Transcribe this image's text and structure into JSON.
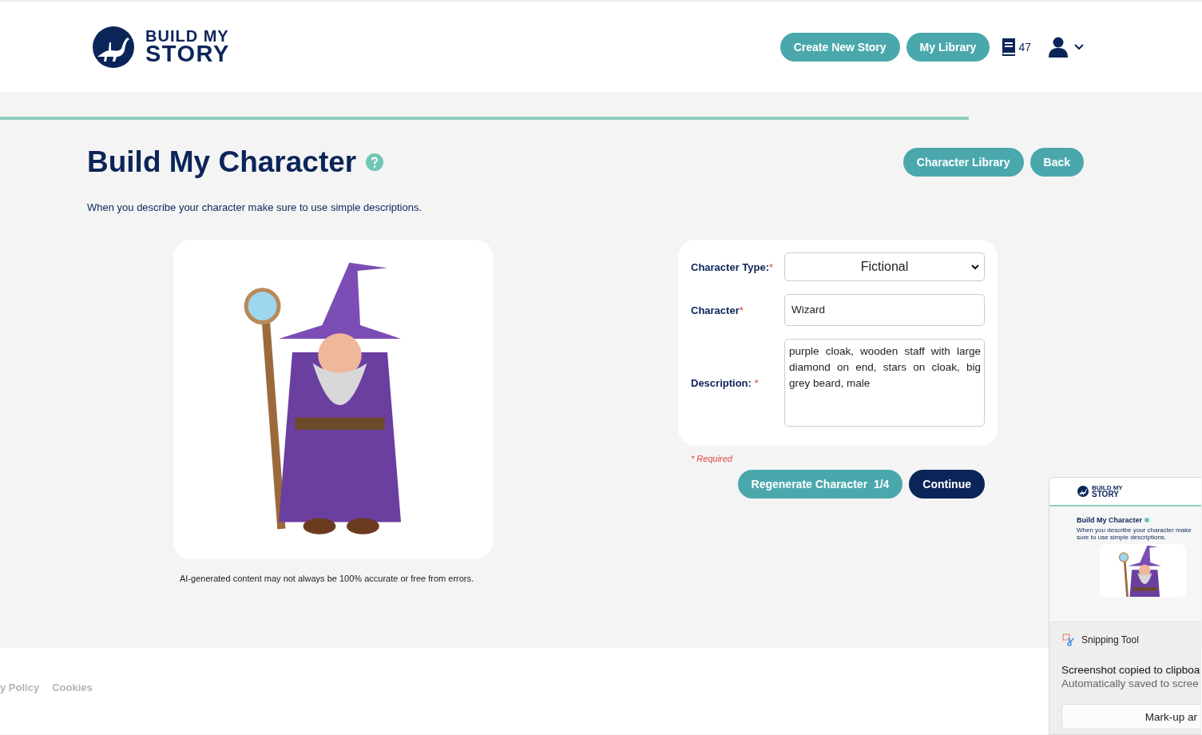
{
  "header": {
    "logo": {
      "line1": "BUILD MY",
      "line2": "STORY"
    },
    "buttons": [
      "Create New Story",
      "My Library"
    ],
    "library_count": "47"
  },
  "progress": {
    "level": 0.806
  },
  "page": {
    "title": "Build My Character",
    "subtitle": "When you describe your character make sure to use simple descriptions.",
    "buttons": [
      "Character Library",
      "Back"
    ]
  },
  "image_card": {
    "disclaimer": "AI-generated content may not always be 100% accurate or free from errors."
  },
  "form": {
    "fields": [
      {
        "kind": "select",
        "label": "Character Type:",
        "required_mark": "*",
        "value": "Fictional"
      },
      {
        "kind": "input",
        "label": "Character",
        "required_mark": "*",
        "value": "Wizard"
      },
      {
        "kind": "textarea",
        "label": "Description: ",
        "required_mark": "*",
        "value": "purple cloak, wooden staff with large diamond on end, stars on cloak, big grey beard, male"
      }
    ],
    "required_note": "* Required",
    "regenerate": {
      "label": "Regenerate Character",
      "count": "1/4"
    },
    "continue": "Continue"
  },
  "footer": {
    "links": [
      "y Policy",
      "Cookies"
    ]
  },
  "notification": {
    "thumbnail": {
      "logo_line1": "BUILD MY",
      "logo_line2": "STORY",
      "title": "Build My Character",
      "subtitle": "When you describe your character make sure to use simple descriptions."
    },
    "app": "Snipping Tool",
    "message": "Screenshot copied to clipboa",
    "detail": "Automatically saved to scree",
    "action": "Mark-up ar"
  }
}
